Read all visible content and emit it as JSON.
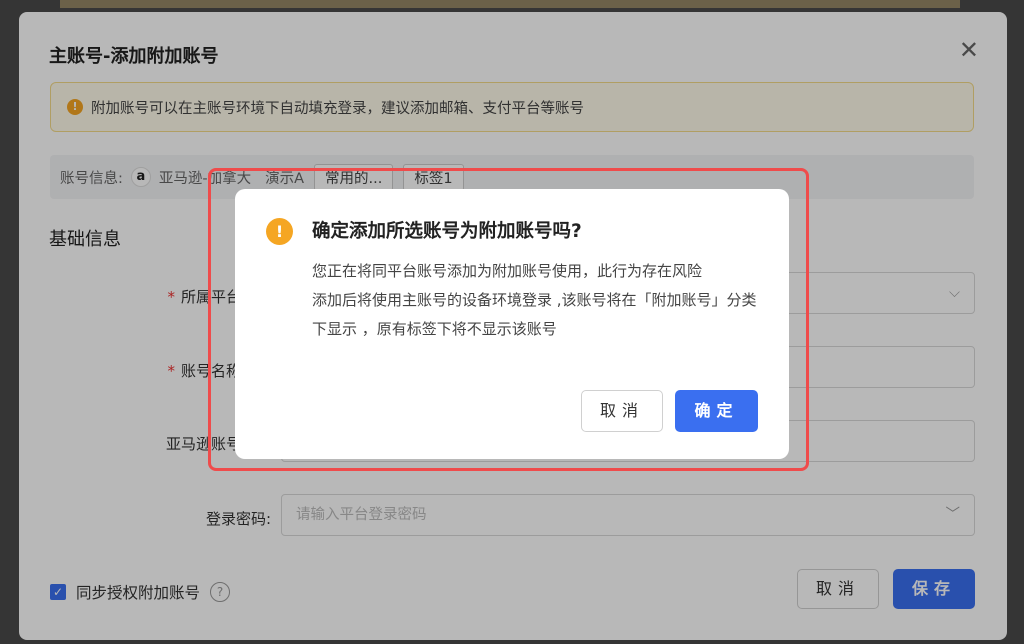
{
  "main_modal": {
    "title": "主账号-添加附加账号",
    "close_label": "✕",
    "notice": "附加账号可以在主账号环境下自动填充登录，建议添加邮箱、支付平台等账号",
    "account_info": {
      "label": "账号信息:",
      "platform": "亚马逊-加拿大",
      "name": "演示A",
      "tags": [
        "常用的...",
        "标签1"
      ]
    },
    "section_title": "基础信息",
    "fields": [
      {
        "label": "所属平台",
        "required": true
      },
      {
        "label": "账号名称",
        "required": true
      },
      {
        "label": "亚马逊账号",
        "required": false
      },
      {
        "label": "登录密码:",
        "required": false,
        "placeholder": "请输入平台登录密码"
      }
    ],
    "sync_checkbox_label": "同步授权附加账号",
    "cancel_label": "取消",
    "save_label": "保存"
  },
  "confirm_dialog": {
    "title": "确定添加所选账号为附加账号吗?",
    "body_lines": [
      "您正在将同平台账号添加为附加账号使用，此行为存在风险",
      "添加后将使用主账号的设备环境登录 ,该账号将在「附加账号」分类下显示 ，原有标签下将不显示该账号"
    ],
    "cancel_label": "取消",
    "ok_label": "确定"
  },
  "colors": {
    "primary": "#3a6ff0",
    "warning": "#f5a623",
    "highlight": "#ef4b4b"
  }
}
